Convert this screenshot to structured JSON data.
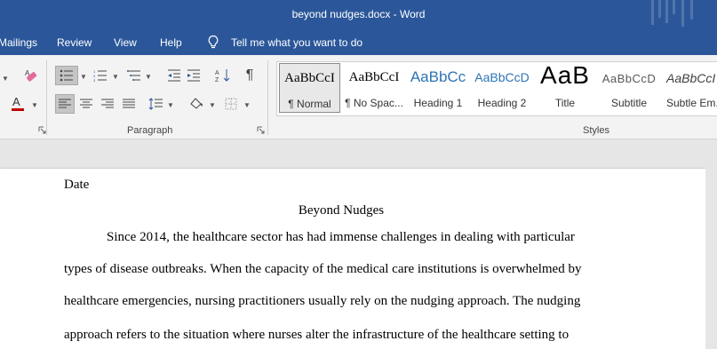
{
  "window": {
    "title": "beyond nudges.docx  -  Word"
  },
  "tabs": [
    {
      "label": "Mailings"
    },
    {
      "label": "Review"
    },
    {
      "label": "View"
    },
    {
      "label": "Help"
    }
  ],
  "tell_me": {
    "label": "Tell me what you want to do"
  },
  "ribbon": {
    "paragraph_label": "Paragraph",
    "styles_label": "Styles",
    "styles": [
      {
        "sample": "AaBbCcI",
        "name": "¶ Normal",
        "selected": true
      },
      {
        "sample": "AaBbCcI",
        "name": "¶ No Spac..."
      },
      {
        "sample": "AaBbCc",
        "name": "Heading 1"
      },
      {
        "sample": "AaBbCcD",
        "name": "Heading 2"
      },
      {
        "sample": "AaB",
        "name": "Title"
      },
      {
        "sample": "AaBbCcD",
        "name": "Subtitle"
      },
      {
        "sample": "AaBbCcI",
        "name": "Subtle Em..."
      }
    ],
    "colors": {
      "font_color": "#c00000",
      "accent": "#2b579a",
      "heading_blue": "#2e74b5"
    }
  },
  "document": {
    "date": "Date",
    "title": "Beyond Nudges",
    "lines": [
      "Since 2014, the healthcare sector has had immense challenges in dealing with particular",
      "types of disease outbreaks. When the capacity of the medical care institutions is overwhelmed by",
      "healthcare emergencies, nursing practitioners usually rely on the nudging approach. The nudging",
      "approach refers to the situation where nurses alter the infrastructure of the healthcare setting to"
    ]
  }
}
